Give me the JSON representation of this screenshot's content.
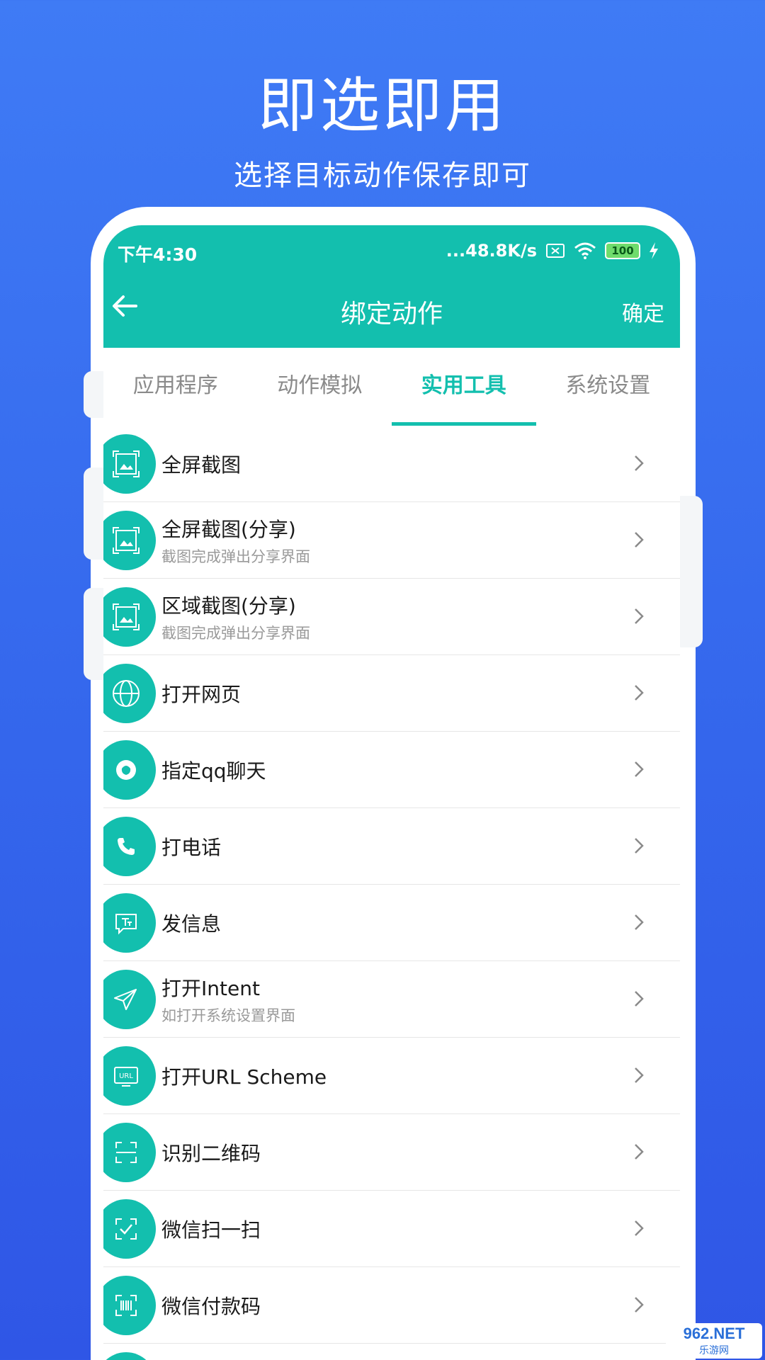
{
  "promo": {
    "title": "即选即用",
    "subtitle": "选择目标动作保存即可"
  },
  "status_bar": {
    "time": "下午4:30",
    "speed": "...48.8K/s",
    "battery": "100"
  },
  "toolbar": {
    "title": "绑定动作",
    "confirm": "确定"
  },
  "tabs": [
    {
      "label": "应用程序",
      "active": false
    },
    {
      "label": "动作模拟",
      "active": false
    },
    {
      "label": "实用工具",
      "active": true
    },
    {
      "label": "系统设置",
      "active": false
    }
  ],
  "items": [
    {
      "title": "全屏截图",
      "subtitle": "",
      "icon": "screenshot-icon"
    },
    {
      "title": "全屏截图(分享)",
      "subtitle": "截图完成弹出分享界面",
      "icon": "screenshot-icon"
    },
    {
      "title": "区域截图(分享)",
      "subtitle": "截图完成弹出分享界面",
      "icon": "screenshot-icon"
    },
    {
      "title": "打开网页",
      "subtitle": "",
      "icon": "globe-icon"
    },
    {
      "title": "指定qq聊天",
      "subtitle": "",
      "icon": "qq-icon"
    },
    {
      "title": "打电话",
      "subtitle": "",
      "icon": "phone-icon"
    },
    {
      "title": "发信息",
      "subtitle": "",
      "icon": "message-icon"
    },
    {
      "title": "打开Intent",
      "subtitle": "如打开系统设置界面",
      "icon": "send-icon"
    },
    {
      "title": "打开URL Scheme",
      "subtitle": "",
      "icon": "url-icon"
    },
    {
      "title": "识别二维码",
      "subtitle": "",
      "icon": "scan-icon"
    },
    {
      "title": "微信扫一扫",
      "subtitle": "",
      "icon": "wechat-scan-icon"
    },
    {
      "title": "微信付款码",
      "subtitle": "",
      "icon": "barcode-icon"
    }
  ],
  "watermark": {
    "top": "962.NET",
    "bottom": "乐游网"
  },
  "colors": {
    "accent": "#13bfae",
    "background": "#3466ec"
  }
}
